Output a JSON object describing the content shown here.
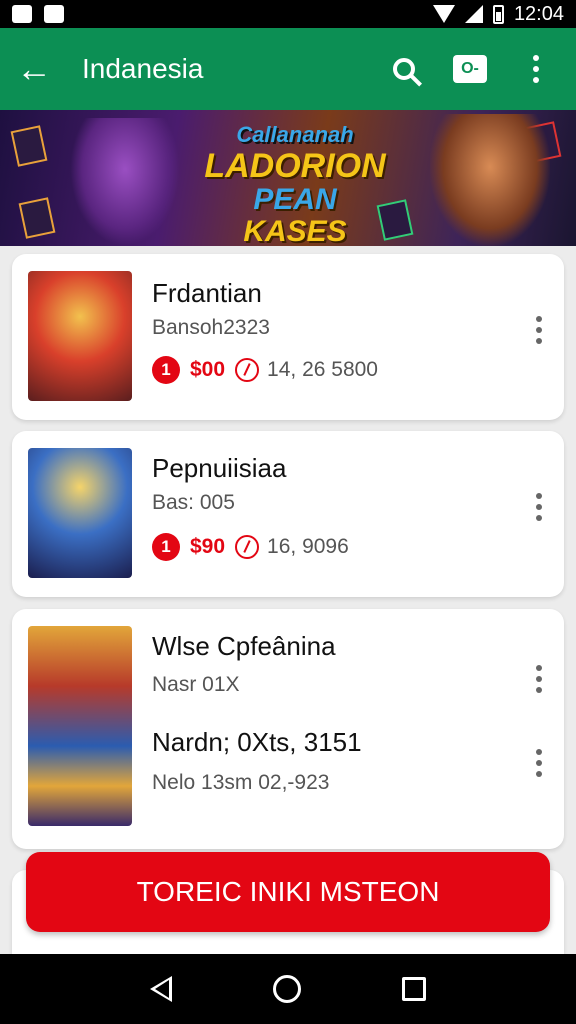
{
  "statusbar": {
    "time": "12:04"
  },
  "appbar": {
    "title": "Indanesia",
    "back_icon": "arrow-left-icon",
    "ticket_label": "O-"
  },
  "banner": {
    "line1": "Callananah",
    "line2": "LADORION",
    "line3a": "PEAN ",
    "line3b": "KASES"
  },
  "cards": [
    {
      "title": "Frdantian",
      "subtitle": "Bansoh2323",
      "badge": "1",
      "price": "$00",
      "meta": "14, 26 5800"
    },
    {
      "title": "Pepnuiisiaa",
      "subtitle": "Bas: 005",
      "badge": "1",
      "price": "$90",
      "meta": "16, 9096"
    },
    {
      "title": "Wlse Cpfeânina",
      "subtitle": "Nasr 01X",
      "line2_title": "Nardn; 0Xts, 3151",
      "line2_sub": "Nelo 13sm 02,-923"
    }
  ],
  "cta": {
    "label": "TOREIC INIKI MSTEON"
  },
  "colors": {
    "appbar": "#0c8f54",
    "accent": "#e30613"
  }
}
